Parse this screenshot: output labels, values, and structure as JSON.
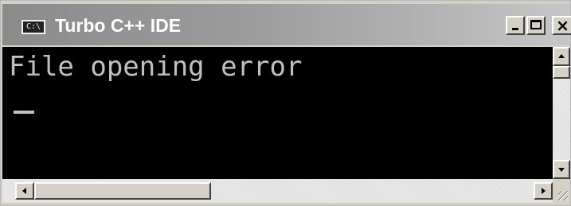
{
  "window": {
    "title": "Turbo C++ IDE",
    "icon_label": "C:\\",
    "icon": "console-app-icon"
  },
  "titlebar_buttons": {
    "minimize": "minimize-icon",
    "maximize": "maximize-icon",
    "close_label": "×",
    "close": "close-icon"
  },
  "console": {
    "lines": [
      "File opening error"
    ],
    "background": "#000000",
    "text_color": "#c0c0c0"
  },
  "colors": {
    "titlebar_start": "#8b8b8b",
    "titlebar_end": "#c7c7c7",
    "chrome": "#d4d0c8"
  }
}
